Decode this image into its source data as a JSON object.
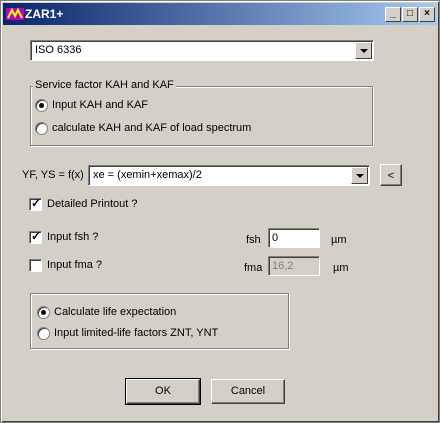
{
  "window": {
    "title": "ZAR1+",
    "minimize": "_",
    "maximize": "□",
    "close": "×"
  },
  "standard_select": {
    "value": "ISO 6336"
  },
  "service_factor": {
    "legend": "Service factor KAH and KAF",
    "options": [
      {
        "label": "Input KAH and KAF",
        "checked": true
      },
      {
        "label": "calculate KAH and KAF of load spectrum",
        "checked": false
      }
    ]
  },
  "yf_ys": {
    "label": "YF, YS = f(x)",
    "value": "xe  = (xemin+xemax)/2",
    "button": "<"
  },
  "detailed_printout": {
    "label": "Detailed Printout ?",
    "checked": true
  },
  "fsh": {
    "check_label": "Input fsh ?",
    "checked": true,
    "field_label": "fsh",
    "value": "0",
    "unit": "µm"
  },
  "fma": {
    "check_label": "Input fma ?",
    "checked": false,
    "field_label": "fma",
    "value": "16,2",
    "unit": "µm"
  },
  "life": {
    "options": [
      {
        "label": "Calculate life expectation",
        "checked": true
      },
      {
        "label": "Input limited-life factors ZNT, YNT",
        "checked": false
      }
    ]
  },
  "buttons": {
    "ok": "OK",
    "cancel": "Cancel"
  }
}
